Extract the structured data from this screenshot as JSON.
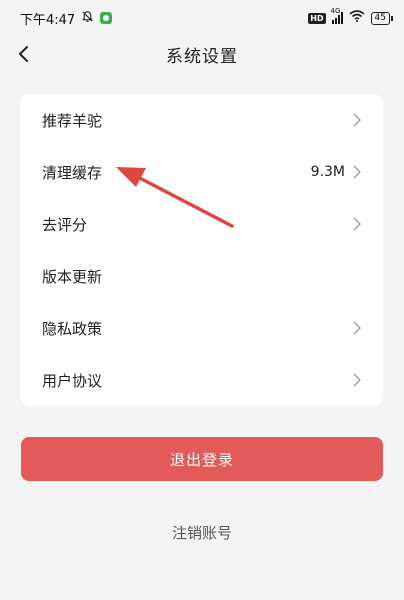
{
  "status_bar": {
    "time": "下午4:47",
    "hd": "HD",
    "network": "4G",
    "battery": "45"
  },
  "header": {
    "title": "系统设置"
  },
  "settings": {
    "items": [
      {
        "label": "推荐羊驼",
        "value": "",
        "has_chevron": true
      },
      {
        "label": "清理缓存",
        "value": "9.3M",
        "has_chevron": true
      },
      {
        "label": "去评分",
        "value": "",
        "has_chevron": true
      },
      {
        "label": "版本更新",
        "value": "",
        "has_chevron": false
      },
      {
        "label": "隐私政策",
        "value": "",
        "has_chevron": true
      },
      {
        "label": "用户协议",
        "value": "",
        "has_chevron": true
      }
    ]
  },
  "actions": {
    "logout_label": "退出登录",
    "cancel_account_label": "注销账号"
  },
  "colors": {
    "page_background": "#f4f4f6",
    "card_background": "#ffffff",
    "logout_button": "#e35b59",
    "annotation_arrow": "#e0463d"
  },
  "icons": {
    "back": "chevron-left-icon",
    "row_arrow": "chevron-right-icon",
    "annotation": "red-arrow-pointing-to-clear-cache"
  }
}
